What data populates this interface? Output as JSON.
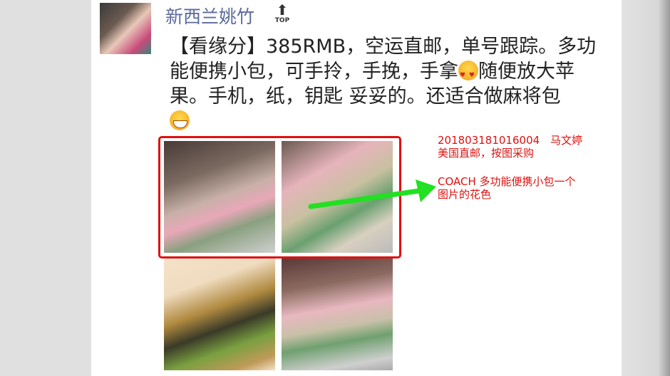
{
  "post": {
    "author": "新西兰姚竹",
    "top_badge": "TOP",
    "text_part1": "【看缘分】385RMB，空运直邮，单号跟踪。多功能便携小包，可手拎，手挽，手拿",
    "emoji1": "heart-eyes-emoji",
    "text_part2": "随便放大苹果。手机，纸，钥匙 妥妥的。还适合做麻将包",
    "emoji2": "grin-emoji"
  },
  "annotation": {
    "line1": "201803181016004　马文婷",
    "line2": "美国直邮，按图采购",
    "line3": "COACH 多功能便携小包一个",
    "line4": "图片的花色",
    "highlight_color": "#e01010",
    "arrow_color": "#22e022"
  }
}
